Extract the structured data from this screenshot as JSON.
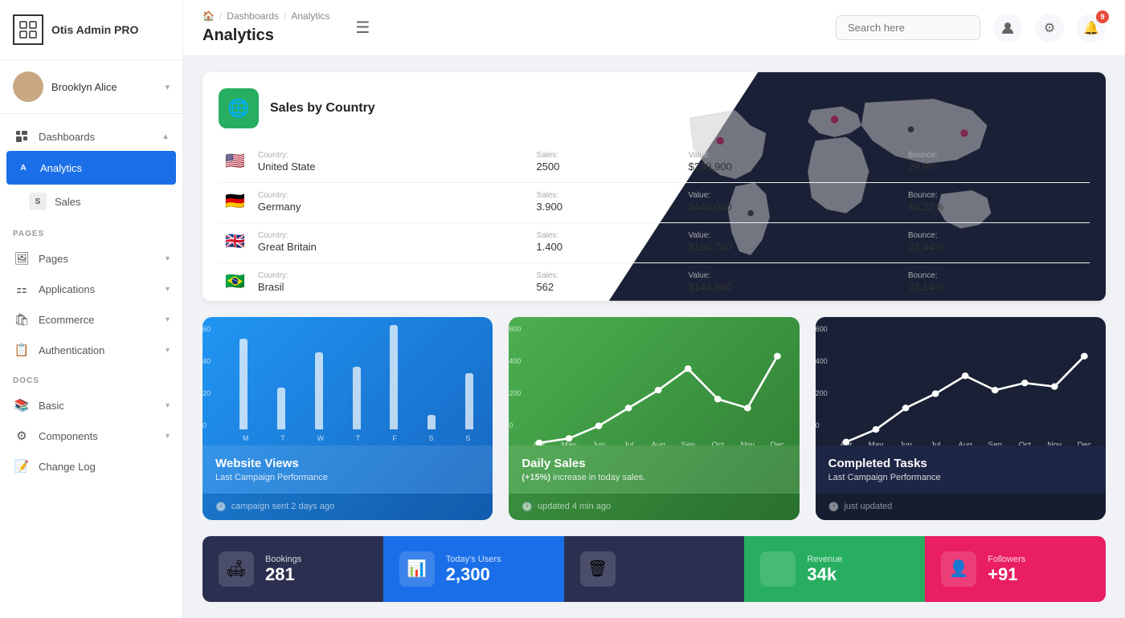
{
  "app": {
    "name": "Otis Admin PRO"
  },
  "user": {
    "name": "Brooklyn Alice"
  },
  "sidebar": {
    "items": [
      {
        "id": "dashboards",
        "label": "Dashboards",
        "icon": "⊞",
        "hasChevron": true,
        "active": false,
        "expanded": true
      },
      {
        "id": "analytics",
        "label": "Analytics",
        "icon": "A",
        "active": true,
        "sub": true
      },
      {
        "id": "sales",
        "label": "Sales",
        "icon": "S",
        "active": false,
        "sub": true
      }
    ],
    "pages_label": "PAGES",
    "pages_items": [
      {
        "id": "pages",
        "label": "Pages",
        "icon": "🖼"
      },
      {
        "id": "applications",
        "label": "Applications",
        "icon": "⚏"
      },
      {
        "id": "ecommerce",
        "label": "Ecommerce",
        "icon": "🛍"
      },
      {
        "id": "authentication",
        "label": "Authentication",
        "icon": "📋"
      }
    ],
    "docs_label": "DOCS",
    "docs_items": [
      {
        "id": "basic",
        "label": "Basic",
        "icon": "📚"
      },
      {
        "id": "components",
        "label": "Components",
        "icon": "⚙"
      },
      {
        "id": "changelog",
        "label": "Change Log",
        "icon": "📝"
      }
    ]
  },
  "topbar": {
    "breadcrumb_home": "🏠",
    "breadcrumb_dash": "Dashboards",
    "breadcrumb_page": "Analytics",
    "page_title": "Analytics",
    "search_placeholder": "Search here",
    "notification_count": "9"
  },
  "sales_by_country": {
    "title": "Sales by Country",
    "rows": [
      {
        "flag": "🇺🇸",
        "country": "United State",
        "sales": "2500",
        "value": "$230,900",
        "bounce": "29.9%"
      },
      {
        "flag": "🇩🇪",
        "country": "Germany",
        "sales": "3.900",
        "value": "$440,000",
        "bounce": "40.22%"
      },
      {
        "flag": "🇬🇧",
        "country": "Great Britain",
        "sales": "1.400",
        "value": "$190,700",
        "bounce": "23.44%"
      },
      {
        "flag": "🇧🇷",
        "country": "Brasil",
        "sales": "562",
        "value": "$143,960",
        "bounce": "32.14%"
      }
    ],
    "col_country": "Country:",
    "col_sales": "Sales:",
    "col_value": "Value:",
    "col_bounce": "Bounce:"
  },
  "chart_website_views": {
    "title": "Website Views",
    "subtitle": "Last Campaign Performance",
    "footer": "campaign sent 2 days ago",
    "y_labels": [
      "60",
      "40",
      "20",
      "0"
    ],
    "bars": [
      {
        "label": "M",
        "height": 65
      },
      {
        "label": "T",
        "height": 30
      },
      {
        "label": "W",
        "height": 55
      },
      {
        "label": "T",
        "height": 45
      },
      {
        "label": "F",
        "height": 75
      },
      {
        "label": "S",
        "height": 10
      },
      {
        "label": "S",
        "height": 40
      }
    ]
  },
  "chart_daily_sales": {
    "title": "Daily Sales",
    "subtitle_prefix": "(+15%)",
    "subtitle_suffix": " increase in today sales.",
    "footer": "updated 4 min ago",
    "y_labels": [
      "600",
      "400",
      "200",
      "0"
    ],
    "x_labels": [
      "Apr",
      "May",
      "Jun",
      "Jul",
      "Aug",
      "Sep",
      "Oct",
      "Nov",
      "Dec"
    ],
    "points": [
      5,
      30,
      100,
      200,
      300,
      420,
      250,
      200,
      490
    ]
  },
  "chart_completed_tasks": {
    "title": "Completed Tasks",
    "subtitle": "Last Campaign Performance",
    "footer": "just updated",
    "y_labels": [
      "600",
      "400",
      "200",
      "0"
    ],
    "x_labels": [
      "Apr",
      "May",
      "Jun",
      "Jul",
      "Aug",
      "Sep",
      "Oct",
      "Nov",
      "Dec"
    ],
    "points": [
      10,
      80,
      200,
      280,
      380,
      300,
      340,
      320,
      490
    ]
  },
  "stats": [
    {
      "label": "Bookings",
      "value": "281",
      "icon": "🛋",
      "color": "#2c3050"
    },
    {
      "label": "Today's Users",
      "value": "2,300",
      "icon": "📊",
      "color": "#1a6fe8"
    },
    {
      "label": "",
      "value": "",
      "icon": "🗑",
      "color": "#2c3050"
    },
    {
      "label": "Revenue",
      "value": "34k",
      "icon": "",
      "color": "#27ae60"
    },
    {
      "label": "Followers",
      "value": "+91",
      "icon": "👤",
      "color": "#e91e63"
    }
  ]
}
